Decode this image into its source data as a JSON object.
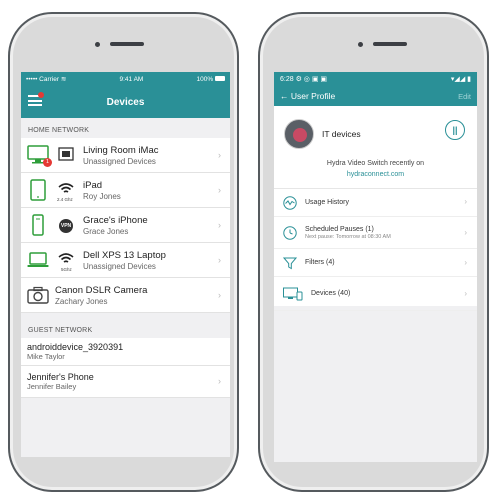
{
  "left_phone": {
    "status": {
      "carrier": "••••• Carrier",
      "wifi_icon": "wifi-icon",
      "time": "9:41 AM",
      "battery": "100%"
    },
    "nav": {
      "title": "Devices",
      "menu_icon": "hamburger-icon"
    },
    "home_section": "HOME NETWORK",
    "home_devices": [
      {
        "name": "Living Room iMac",
        "sub": "Unassigned Devices",
        "icon": "desktop-icon",
        "badge": "1",
        "type_icon": "ethernet-icon"
      },
      {
        "name": "iPad",
        "sub": "Roy Jones",
        "icon": "tablet-icon",
        "type_icon": "wifi-icon",
        "band": "2.4 Ghz"
      },
      {
        "name": "Grace's iPhone",
        "sub": "Grace Jones",
        "icon": "phone-icon",
        "type_icon": "vpn-icon",
        "vpn": "VPN"
      },
      {
        "name": "Dell XPS 13 Laptop",
        "sub": "Unassigned Devices",
        "icon": "laptop-icon",
        "type_icon": "wifi-icon",
        "band": "5Ghz"
      },
      {
        "name": "Canon DSLR Camera",
        "sub": "Zachary Jones",
        "icon": "camera-icon"
      }
    ],
    "guest_section": "GUEST NETWORK",
    "guest_devices": [
      {
        "name": "androiddevice_3920391",
        "sub": "Mike Taylor"
      },
      {
        "name": "Jennifer's Phone",
        "sub": "Jennifer Bailey"
      }
    ]
  },
  "right_phone": {
    "status": {
      "time": "6:28"
    },
    "nav": {
      "back": "← User Profile",
      "edit": "Edit"
    },
    "profile": {
      "name": "IT devices",
      "pause_icon": "pause-icon"
    },
    "note": {
      "text": "Hydra Video Switch recently on",
      "link": "hydraconnect.com"
    },
    "menu": [
      {
        "label": "Usage History",
        "icon": "activity-icon"
      },
      {
        "label": "Scheduled Pauses (1)",
        "sub": "Next pause: Tomorrow at 08:30 AM",
        "icon": "clock-icon"
      },
      {
        "label": "Filters (4)",
        "icon": "filter-icon"
      },
      {
        "label": "Devices (40)",
        "icon": "devices-icon"
      }
    ]
  },
  "colors": {
    "accent": "#2a9097",
    "badge": "#e53935"
  }
}
